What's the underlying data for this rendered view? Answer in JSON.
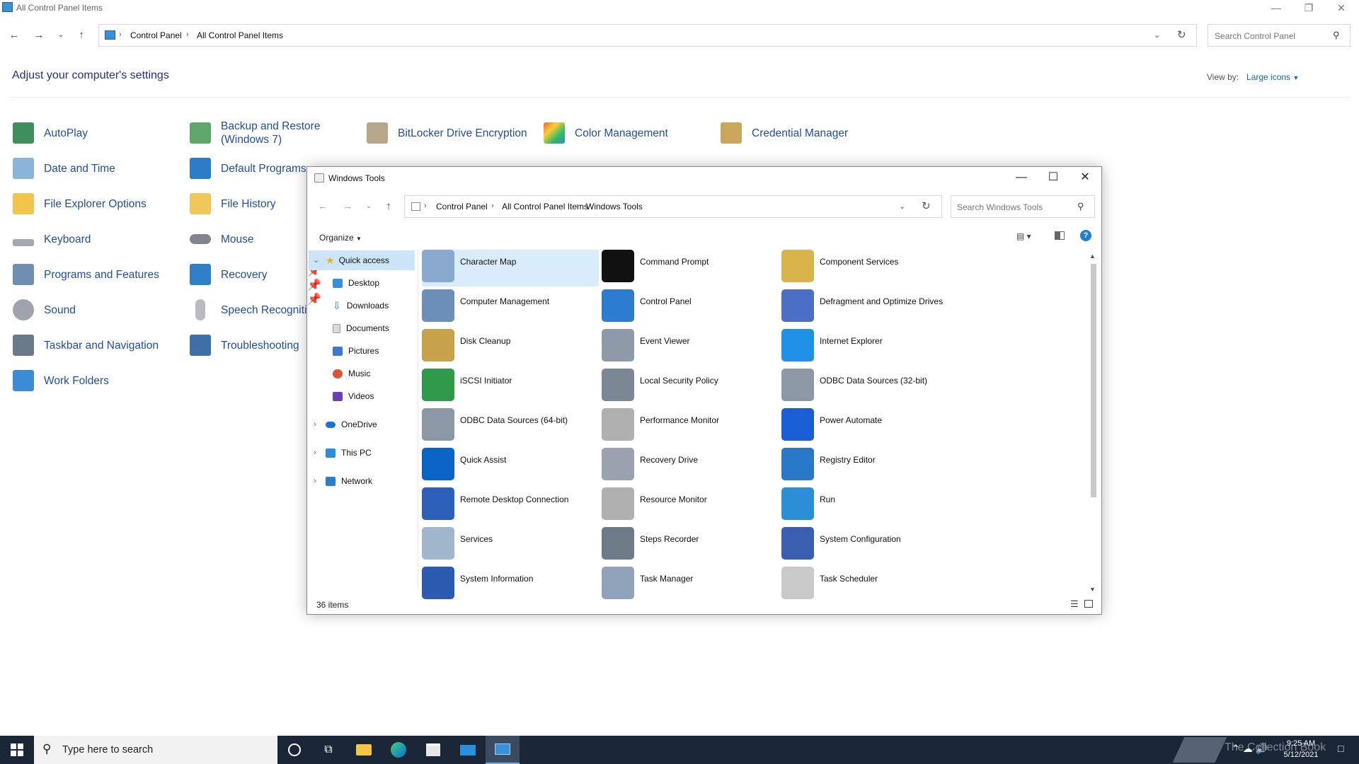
{
  "cp": {
    "title": "All Control Panel Items",
    "breadcrumb": [
      "Control Panel",
      "All Control Panel Items"
    ],
    "search_placeholder": "Search Control Panel",
    "heading": "Adjust your computer's settings",
    "view_by_label": "View by:",
    "view_by_value": "Large icons",
    "items": [
      {
        "label": "AutoPlay",
        "icon": "autoplay-icon"
      },
      {
        "label": "Backup and Restore (Windows 7)",
        "icon": "backup-icon"
      },
      {
        "label": "BitLocker Drive Encryption",
        "icon": "bitlocker-icon"
      },
      {
        "label": "Color Management",
        "icon": "color-management-icon"
      },
      {
        "label": "Credential Manager",
        "icon": "credential-icon"
      },
      {
        "label": "Date and Time",
        "icon": "date-time-icon"
      },
      {
        "label": "Default Programs",
        "icon": "default-programs-icon"
      },
      {
        "label": "File Explorer Options",
        "icon": "folder-options-icon"
      },
      {
        "label": "File History",
        "icon": "file-history-icon"
      },
      {
        "label": "Keyboard",
        "icon": "keyboard-icon"
      },
      {
        "label": "Mouse",
        "icon": "mouse-icon"
      },
      {
        "label": "Programs and Features",
        "icon": "programs-icon"
      },
      {
        "label": "Recovery",
        "icon": "recovery-icon"
      },
      {
        "label": "Sound",
        "icon": "sound-icon"
      },
      {
        "label": "Speech Recogniti",
        "icon": "speech-icon"
      },
      {
        "label": "Taskbar and Navigation",
        "icon": "taskbar-icon"
      },
      {
        "label": "Troubleshooting",
        "icon": "troubleshooting-icon"
      },
      {
        "label": "Work Folders",
        "icon": "work-folders-icon"
      }
    ]
  },
  "wt": {
    "title": "Windows Tools",
    "breadcrumb": [
      "Control Panel",
      "All Control Panel Items",
      "Windows Tools"
    ],
    "search_placeholder": "Search Windows Tools",
    "organize": "Organize",
    "nav": {
      "quick_access": "Quick access",
      "pinned": [
        "Desktop",
        "Downloads",
        "Documents",
        "Pictures",
        "Music",
        "Videos"
      ],
      "roots": [
        "OneDrive",
        "This PC",
        "Network"
      ]
    },
    "tools": [
      {
        "label": "Character Map",
        "color": "#8aa9cf"
      },
      {
        "label": "Command Prompt",
        "color": "#111111"
      },
      {
        "label": "Component Services",
        "color": "#d9b44a"
      },
      {
        "label": "Computer Management",
        "color": "#6b8fb8"
      },
      {
        "label": "Control Panel",
        "color": "#2c7cd1"
      },
      {
        "label": "Defragment and Optimize Drives",
        "color": "#4a6fc4"
      },
      {
        "label": "Disk Cleanup",
        "color": "#c8a24a"
      },
      {
        "label": "Event Viewer",
        "color": "#8f9aa8"
      },
      {
        "label": "Internet Explorer",
        "color": "#1e90e6"
      },
      {
        "label": "iSCSI Initiator",
        "color": "#2f9a4a"
      },
      {
        "label": "Local Security Policy",
        "color": "#7c8796"
      },
      {
        "label": "ODBC Data Sources (32-bit)",
        "color": "#8d98a6"
      },
      {
        "label": "ODBC Data Sources (64-bit)",
        "color": "#8d98a6"
      },
      {
        "label": "Performance Monitor",
        "color": "#b0b0b0"
      },
      {
        "label": "Power Automate",
        "color": "#1a5fd6"
      },
      {
        "label": "Quick Assist",
        "color": "#0a64c8"
      },
      {
        "label": "Recovery Drive",
        "color": "#9aa3ad"
      },
      {
        "label": "Registry Editor",
        "color": "#2a78c8"
      },
      {
        "label": "Remote Desktop Connection",
        "color": "#2b5fb8"
      },
      {
        "label": "Resource Monitor",
        "color": "#b0b0b0"
      },
      {
        "label": "Run",
        "color": "#2c8fd6"
      },
      {
        "label": "Services",
        "color": "#9fb6cc"
      },
      {
        "label": "Steps Recorder",
        "color": "#6d7a88"
      },
      {
        "label": "System Configuration",
        "color": "#3b5fb0"
      },
      {
        "label": "System Information",
        "color": "#2a5bb0"
      },
      {
        "label": "Task Manager",
        "color": "#8fa3b8"
      },
      {
        "label": "Task Scheduler",
        "color": "#c9c9c9"
      }
    ],
    "status": "36 items"
  },
  "taskbar": {
    "search_placeholder": "Type here to search",
    "time": "9:25 AM",
    "date": "5/12/2021",
    "watermark": "The Collection Book"
  }
}
